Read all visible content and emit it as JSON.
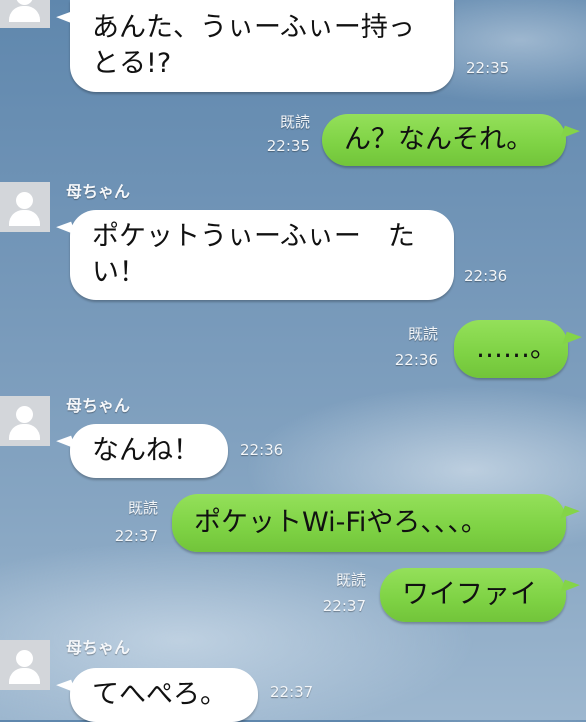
{
  "messages": [
    {
      "side": "in",
      "text_lines": [
        "あんた、うぃーふぃー持っ",
        "とる!?"
      ],
      "time": "22:35"
    },
    {
      "side": "out",
      "text": "ん？なんそれ。",
      "read": "既読",
      "time": "22:35"
    },
    {
      "side": "in",
      "sender": "母ちゃん",
      "text_lines": [
        "ポケットうぃーふぃー　た",
        "い！"
      ],
      "time": "22:36"
    },
    {
      "side": "out",
      "text": "……。",
      "read": "既読",
      "time": "22:36"
    },
    {
      "side": "in",
      "sender": "母ちゃん",
      "text": "なんね！",
      "time": "22:36"
    },
    {
      "side": "out",
      "text": "ポケットWi-Fiやろ、、、。",
      "read": "既読",
      "time": "22:37"
    },
    {
      "side": "out",
      "text": "ワイファイ",
      "read": "既読",
      "time": "22:37"
    },
    {
      "side": "in",
      "sender": "母ちゃん",
      "text": "てへぺろ。",
      "time": "22:37"
    }
  ],
  "colors": {
    "incoming_bubble": "#ffffff",
    "outgoing_bubble": "#7ed244",
    "background": "#7396b8"
  }
}
